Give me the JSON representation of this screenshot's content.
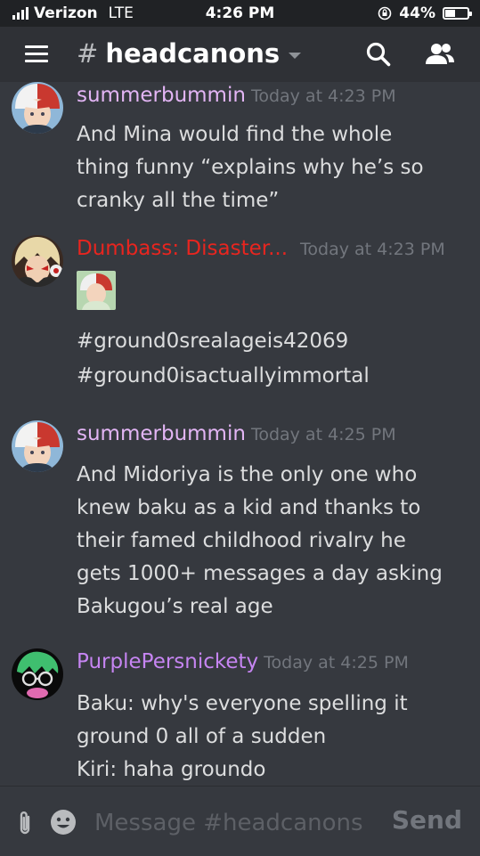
{
  "status": {
    "carrier": "Verizon",
    "network": "LTE",
    "time": "4:26 PM",
    "battery": "44%",
    "battery_level": 0.44
  },
  "header": {
    "channel_hash": "#",
    "channel_name": "headcanons",
    "menu_icon": "hamburger-icon",
    "search_icon": "search-icon",
    "members_icon": "members-icon"
  },
  "messages": [
    {
      "author": "summerbummin",
      "author_color": "#e3b5f5",
      "time": "Today at 4:23 PM",
      "lines": [
        "And Mina would find the whole",
        "thing funny “explains why he’s so",
        "cranky all the time”"
      ]
    },
    {
      "author": "Dumbass: Disaster...",
      "author_color": "#e8251f",
      "time": "Today at 4:23 PM",
      "lines": [
        "#ground0srealageis42069",
        "#ground0isactuallyimmortal"
      ]
    },
    {
      "author": "summerbummin",
      "author_color": "#e3b5f5",
      "time": "Today at 4:25 PM",
      "lines": [
        "And Midoriya is the only one who",
        "knew baku as a kid  and thanks to",
        "their famed childhood rivalry he",
        "gets 1000+ messages a day asking",
        "Bakugou’s real age"
      ]
    },
    {
      "author": "PurplePersnickety",
      "author_color": "#c685f2",
      "time": "Today at 4:25 PM",
      "lines": [
        "Baku: why's everyone spelling it",
        "ground 0 all of a sudden",
        "Kiri: haha groundo"
      ]
    }
  ],
  "composer": {
    "placeholder": "Message #headcanons",
    "send_label": "Send"
  }
}
